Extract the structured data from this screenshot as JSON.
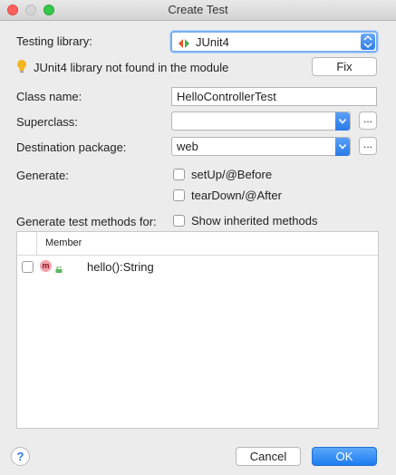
{
  "window": {
    "title": "Create Test"
  },
  "testing_library": {
    "label": "Testing library:",
    "value": "JUnit4"
  },
  "warning": {
    "text": "JUnit4 library not found in the module",
    "fix_label": "Fix"
  },
  "class_name": {
    "label": "Class name:",
    "value": "HelloControllerTest"
  },
  "superclass": {
    "label": "Superclass:",
    "value": "",
    "browse_label": "..."
  },
  "destination_package": {
    "label": "Destination package:",
    "value": "web",
    "browse_label": "..."
  },
  "generate": {
    "label": "Generate:",
    "options": [
      {
        "label": "setUp/@Before",
        "checked": false
      },
      {
        "label": "tearDown/@After",
        "checked": false
      }
    ]
  },
  "test_methods": {
    "label": "Generate test methods for:",
    "show_inherited_label": "Show inherited methods",
    "column_member": "Member",
    "rows": [
      {
        "badge": "m",
        "name": "hello():String",
        "checked": false
      }
    ]
  },
  "buttons": {
    "help": "?",
    "cancel": "Cancel",
    "ok": "OK"
  },
  "colors": {
    "accent": "#2f7de9",
    "method_badge": "#f4a3ad"
  },
  "icons": [
    "junit-icon",
    "lightbulb-icon",
    "method-icon",
    "lock-icon",
    "help-icon",
    "chevron-down-icon",
    "stepper-icon"
  ]
}
